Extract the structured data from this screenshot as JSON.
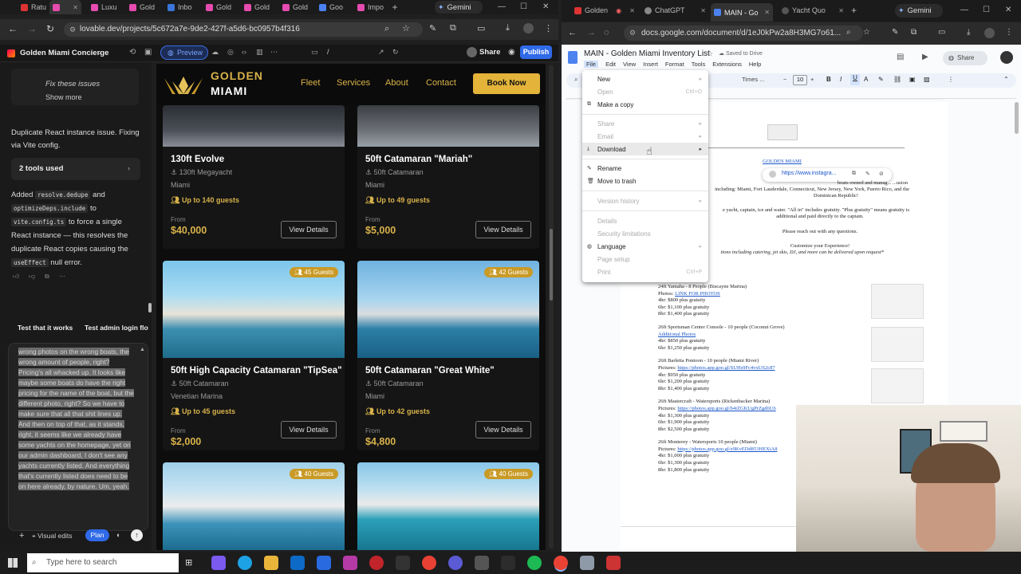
{
  "left_browser": {
    "tabs": [
      {
        "label": "Ratu"
      },
      {
        "label": "Luxu"
      },
      {
        "label": "Gold"
      },
      {
        "label": "Inbo"
      },
      {
        "label": "Gold"
      },
      {
        "label": "Gold"
      },
      {
        "label": "Gold"
      },
      {
        "label": "Goo"
      },
      {
        "label": "Impo"
      }
    ],
    "gemini_label": "Gemini",
    "url": "lovable.dev/projects/5c672a7e-9de2-427f-a5d6-bc0957b4f316",
    "project_name": "Golden Miami Concierge",
    "preview_label": "Preview",
    "path": "/",
    "share_label": "Share",
    "publish_label": "Publish",
    "chat": {
      "fix_title": "Fix these issues",
      "show_more": "Show more",
      "msg1": "Duplicate React instance issue. Fixing via Vite config.",
      "tools_used": "2 tools used",
      "added": "Added",
      "code1": "resolve.dedupe",
      "and": "and",
      "code2": "optimizeDeps.include",
      "to": "to",
      "code3": "vite.config.ts",
      "msg2": "to force a single React instance — this resolves the duplicate React copies causing the",
      "code4": "useEffect",
      "msg3": "null error.",
      "suggest1": "Test that it works",
      "suggest2": "Test admin login flow",
      "input_text": "wrong photos on the wrong boats, the wrong amount of people, right? Pricing's all whacked up. It looks like maybe some boats do have the right pricing for the name of the boat, but the different photo, right? So we have to make sure that all that shit lines up. And then on top of that, as it stands, right, it seems like we already have some yachts on the homepage, yet on our admin dashboard, I don't see any yachts currently listed. And everything that's currently listed does need to be on here already, by nature. Um, yeah.",
      "visual_edits": "Visual edits",
      "plan": "Plan"
    },
    "site": {
      "brand_top": "GOLDEN",
      "brand_bottom": "MIAMI",
      "nav": [
        "Fleet",
        "Services",
        "About",
        "Contact"
      ],
      "book": "Book Now",
      "cards": [
        {
          "name": "130ft Evolve",
          "type": "130ft Megayacht",
          "loc": "Miami",
          "guests": "Up to 140 guests",
          "from": "From",
          "price": "$40,000",
          "cta": "View Details"
        },
        {
          "name": "50ft Catamaran \"Mariah\"",
          "type": "50ft Catamaran",
          "loc": "Miami",
          "guests": "Up to 49 guests",
          "from": "From",
          "price": "$5,000",
          "cta": "View Details"
        },
        {
          "badge": "45 Guests",
          "name": "50ft High Capacity Catamaran \"TipSea\"",
          "type": "50ft Catamaran",
          "loc": "Venetian Marina",
          "guests": "Up to 45 guests",
          "from": "From",
          "price": "$2,000",
          "cta": "View Details"
        },
        {
          "badge": "42 Guests",
          "name": "50ft Catamaran \"Great White\"",
          "type": "50ft Catamaran",
          "loc": "Miami",
          "guests": "Up to 42 guests",
          "from": "From",
          "price": "$4,800",
          "cta": "View Details"
        },
        {
          "badge": "40 Guests"
        },
        {
          "badge": "40 Guests"
        }
      ]
    }
  },
  "right_browser": {
    "tabs": [
      {
        "label": "Golden"
      },
      {
        "label": "ChatGPT"
      },
      {
        "label": "MAIN - Go"
      },
      {
        "label": "Yacht Quo"
      }
    ],
    "gemini_label": "Gemini",
    "url": "docs.google.com/document/d/1eJ0kPw2a8H3MG7o61...",
    "doc_title": "MAIN - Golden Miami Inventory List",
    "saved": "Saved to Drive",
    "menus": [
      "File",
      "Edit",
      "View",
      "Insert",
      "Format",
      "Tools",
      "Extensions",
      "Help"
    ],
    "share": "Share",
    "font": "Times ...",
    "font_size": "10",
    "file_menu": [
      {
        "label": "New",
        "sc": "▸",
        "enabled": true
      },
      {
        "label": "Open",
        "sc": "Ctrl+O",
        "enabled": false
      },
      {
        "label": "Make a copy",
        "sc": "",
        "enabled": true
      },
      {
        "label": "Share",
        "sc": "▸",
        "enabled": false
      },
      {
        "label": "Email",
        "sc": "▸",
        "enabled": false
      },
      {
        "label": "Download",
        "sc": "▸",
        "enabled": true
      },
      {
        "label": "Rename",
        "sc": "",
        "enabled": true
      },
      {
        "label": "Move to trash",
        "sc": "",
        "enabled": true
      },
      {
        "label": "Version history",
        "sc": "▸",
        "enabled": false
      },
      {
        "label": "Details",
        "sc": "",
        "enabled": false
      },
      {
        "label": "Security limitations",
        "sc": "",
        "enabled": false
      },
      {
        "label": "Language",
        "sc": "▸",
        "enabled": true
      },
      {
        "label": "Page setup",
        "sc": "",
        "enabled": false
      },
      {
        "label": "Print",
        "sc": "Ctrl+P",
        "enabled": false
      }
    ],
    "link_chip": "https://www.instagra...",
    "doc": {
      "heading": "GOLDEN MIAMI",
      "p1a": "boats owned and manag... ...usion",
      "p1b": "including: Miami, Fort Lauderdale, Connecticut, New Jersey, New York, Puerto Rico, and the",
      "p1c": "Dominican Republic!",
      "p2a": "e yacht, captain, ice and water. \"All in\" includes gratuity. \"Plus gratuity\" means gratuity is",
      "p2b": "additional and paid directly to the captain.",
      "p3": "Please reach out with any questions.",
      "p4": "Customize your Experience!",
      "p5": "tions including catering, jet skis, DJ, and more can be delivered upon request*",
      "boats": [
        {
          "title": "24ft Yamaha - 8 People (Biscayne Marina)",
          "pl": "Photos:",
          "link": "LINK FOR PHOTOS",
          "rates": [
            "4hr: $800 plus gratuity",
            "6hr: $1,100 plus gratuity",
            "8hr: $1,400 plus gratuity"
          ]
        },
        {
          "title": "26ft Sportsman Center Console - 10 people (Coconut Grove)",
          "pl": "",
          "link": "Additional Photos",
          "rates": [
            "4hr: $850 plus gratuity",
            "6hr: $1,250 plus gratuity"
          ]
        },
        {
          "title": "26ft Barletta Pontoon - 10 people (Miami River)",
          "pl": "Pictures:",
          "link": "https://photos.app.goo.gl/SUHs9Fc4vxUS2c87",
          "rates": [
            "4hr: $950 plus gratuity",
            "6hr: $1,200 plus gratuity",
            "8hr: $1,400 plus gratuity"
          ]
        },
        {
          "title": "26ft Mastercraft - Watersports (Rickenbacker Marina)",
          "pl": "Pictures:",
          "link": "https://photos.app.goo.gl/b4iZGKUgPrZgd6U6",
          "rates": [
            "4hr: $1,300 plus gratuity",
            "6hr: $1,900 plus gratuity",
            "8hr: $2,500 plus gratuity"
          ]
        },
        {
          "title": "26ft Monterey - Watersports 10 people (Miami)",
          "pl": "Pictures:",
          "link": "https://photos.app.goo.gl/z9KvEDd853HEXiA8",
          "rates": [
            "4hr: $1,000 plus gratuity",
            "6hr: $1,300 plus gratuity",
            "8hr: $1,800 plus gratuity"
          ]
        }
      ]
    }
  },
  "taskbar": {
    "search_placeholder": "Type here to search"
  }
}
